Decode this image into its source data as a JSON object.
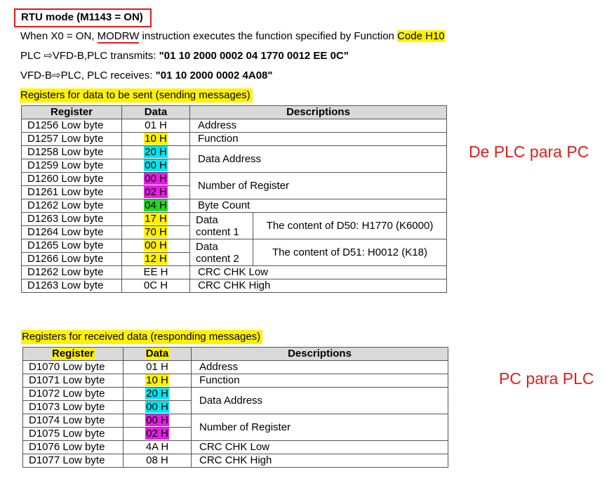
{
  "header": {
    "title": "RTU mode (M1143 = ON)",
    "line1_pre": "When X0 = ON, ",
    "line1_modrw": "MODRW",
    "line1_mid": " instruction executes the function specified by Function ",
    "line1_code": "Code H10",
    "line2_pre": "PLC ⇨VFD-B,PLC transmits: ",
    "line2_msg": "\"01 10 2000 0002 04 1770 0012 EE 0C\"",
    "line3_pre": "VFD-B⇨PLC, PLC receives: ",
    "line3_msg": "\"01 10 2000 0002 4A08\""
  },
  "send_table": {
    "caption": "Registers for data to be sent (sending messages)",
    "headers": [
      "Register",
      "Data",
      "Descriptions"
    ],
    "rows": [
      {
        "register": "D1256 Low byte",
        "data": "01 H",
        "color": ""
      },
      {
        "register": "D1257 Low byte",
        "data": "10 H",
        "color": "#fff200"
      },
      {
        "register": "D1258 Low byte",
        "data": "20 H",
        "color": "#00e5ef"
      },
      {
        "register": "D1259 Low byte",
        "data": "00 H",
        "color": "#00e5ef"
      },
      {
        "register": "D1260 Low byte",
        "data": "00 H",
        "color": "#e21ee2"
      },
      {
        "register": "D1261 Low byte",
        "data": "02 H",
        "color": "#e21ee2"
      },
      {
        "register": "D1262 Low byte",
        "data": "04 H",
        "color": "#22d62a"
      },
      {
        "register": "D1263 Low byte",
        "data": "17 H",
        "color": "#fff200"
      },
      {
        "register": "D1264 Low byte",
        "data": "70 H",
        "color": "#fff200"
      },
      {
        "register": "D1265 Low byte",
        "data": "00 H",
        "color": "#fff200"
      },
      {
        "register": "D1266 Low byte",
        "data": "12 H",
        "color": "#fff200"
      },
      {
        "register": "D1262 Low byte",
        "data": "EE H",
        "color": ""
      },
      {
        "register": "D1263 Low byte",
        "data": "0C H",
        "color": ""
      }
    ],
    "desc": {
      "address": "Address",
      "function": "Function",
      "data_address": "Data Address",
      "num_register": "Number of Register",
      "byte_count": "Byte Count",
      "content1_a": "Data",
      "content1_b": "content 1",
      "content1_detail": "The content of D50: H1770 (K6000)",
      "content2_a": "Data",
      "content2_b": "content 2",
      "content2_detail": "The content of D51: H0012 (K18)",
      "crc_low": "CRC CHK Low",
      "crc_high": "CRC CHK High"
    }
  },
  "recv_table": {
    "caption": "Registers for received data (responding messages)",
    "headers": [
      "Register",
      "Data",
      "Descriptions"
    ],
    "rows": [
      {
        "register": "D1070 Low byte",
        "data": "01 H",
        "color": ""
      },
      {
        "register": "D1071 Low byte",
        "data": "10 H",
        "color": "#fff200"
      },
      {
        "register": "D1072 Low byte",
        "data": "20 H",
        "color": "#00e5ef"
      },
      {
        "register": "D1073 Low byte",
        "data": "00 H",
        "color": "#00e5ef"
      },
      {
        "register": "D1074 Low byte",
        "data": "00 H",
        "color": "#e21ee2"
      },
      {
        "register": "D1075 Low byte",
        "data": "02 H",
        "color": "#e21ee2"
      },
      {
        "register": "D1076 Low byte",
        "data": "4A H",
        "color": ""
      },
      {
        "register": "D1077 Low byte",
        "data": "08 H",
        "color": ""
      }
    ],
    "desc": {
      "address": "Address",
      "function": "Function",
      "data_address": "Data Address",
      "num_register": "Number of Register",
      "crc_low": "CRC CHK Low",
      "crc_high": "CRC CHK High"
    }
  },
  "annotations": {
    "send_note": "De PLC para PC",
    "recv_note": "PC para PLC",
    "note_color": "#e01c1c"
  }
}
